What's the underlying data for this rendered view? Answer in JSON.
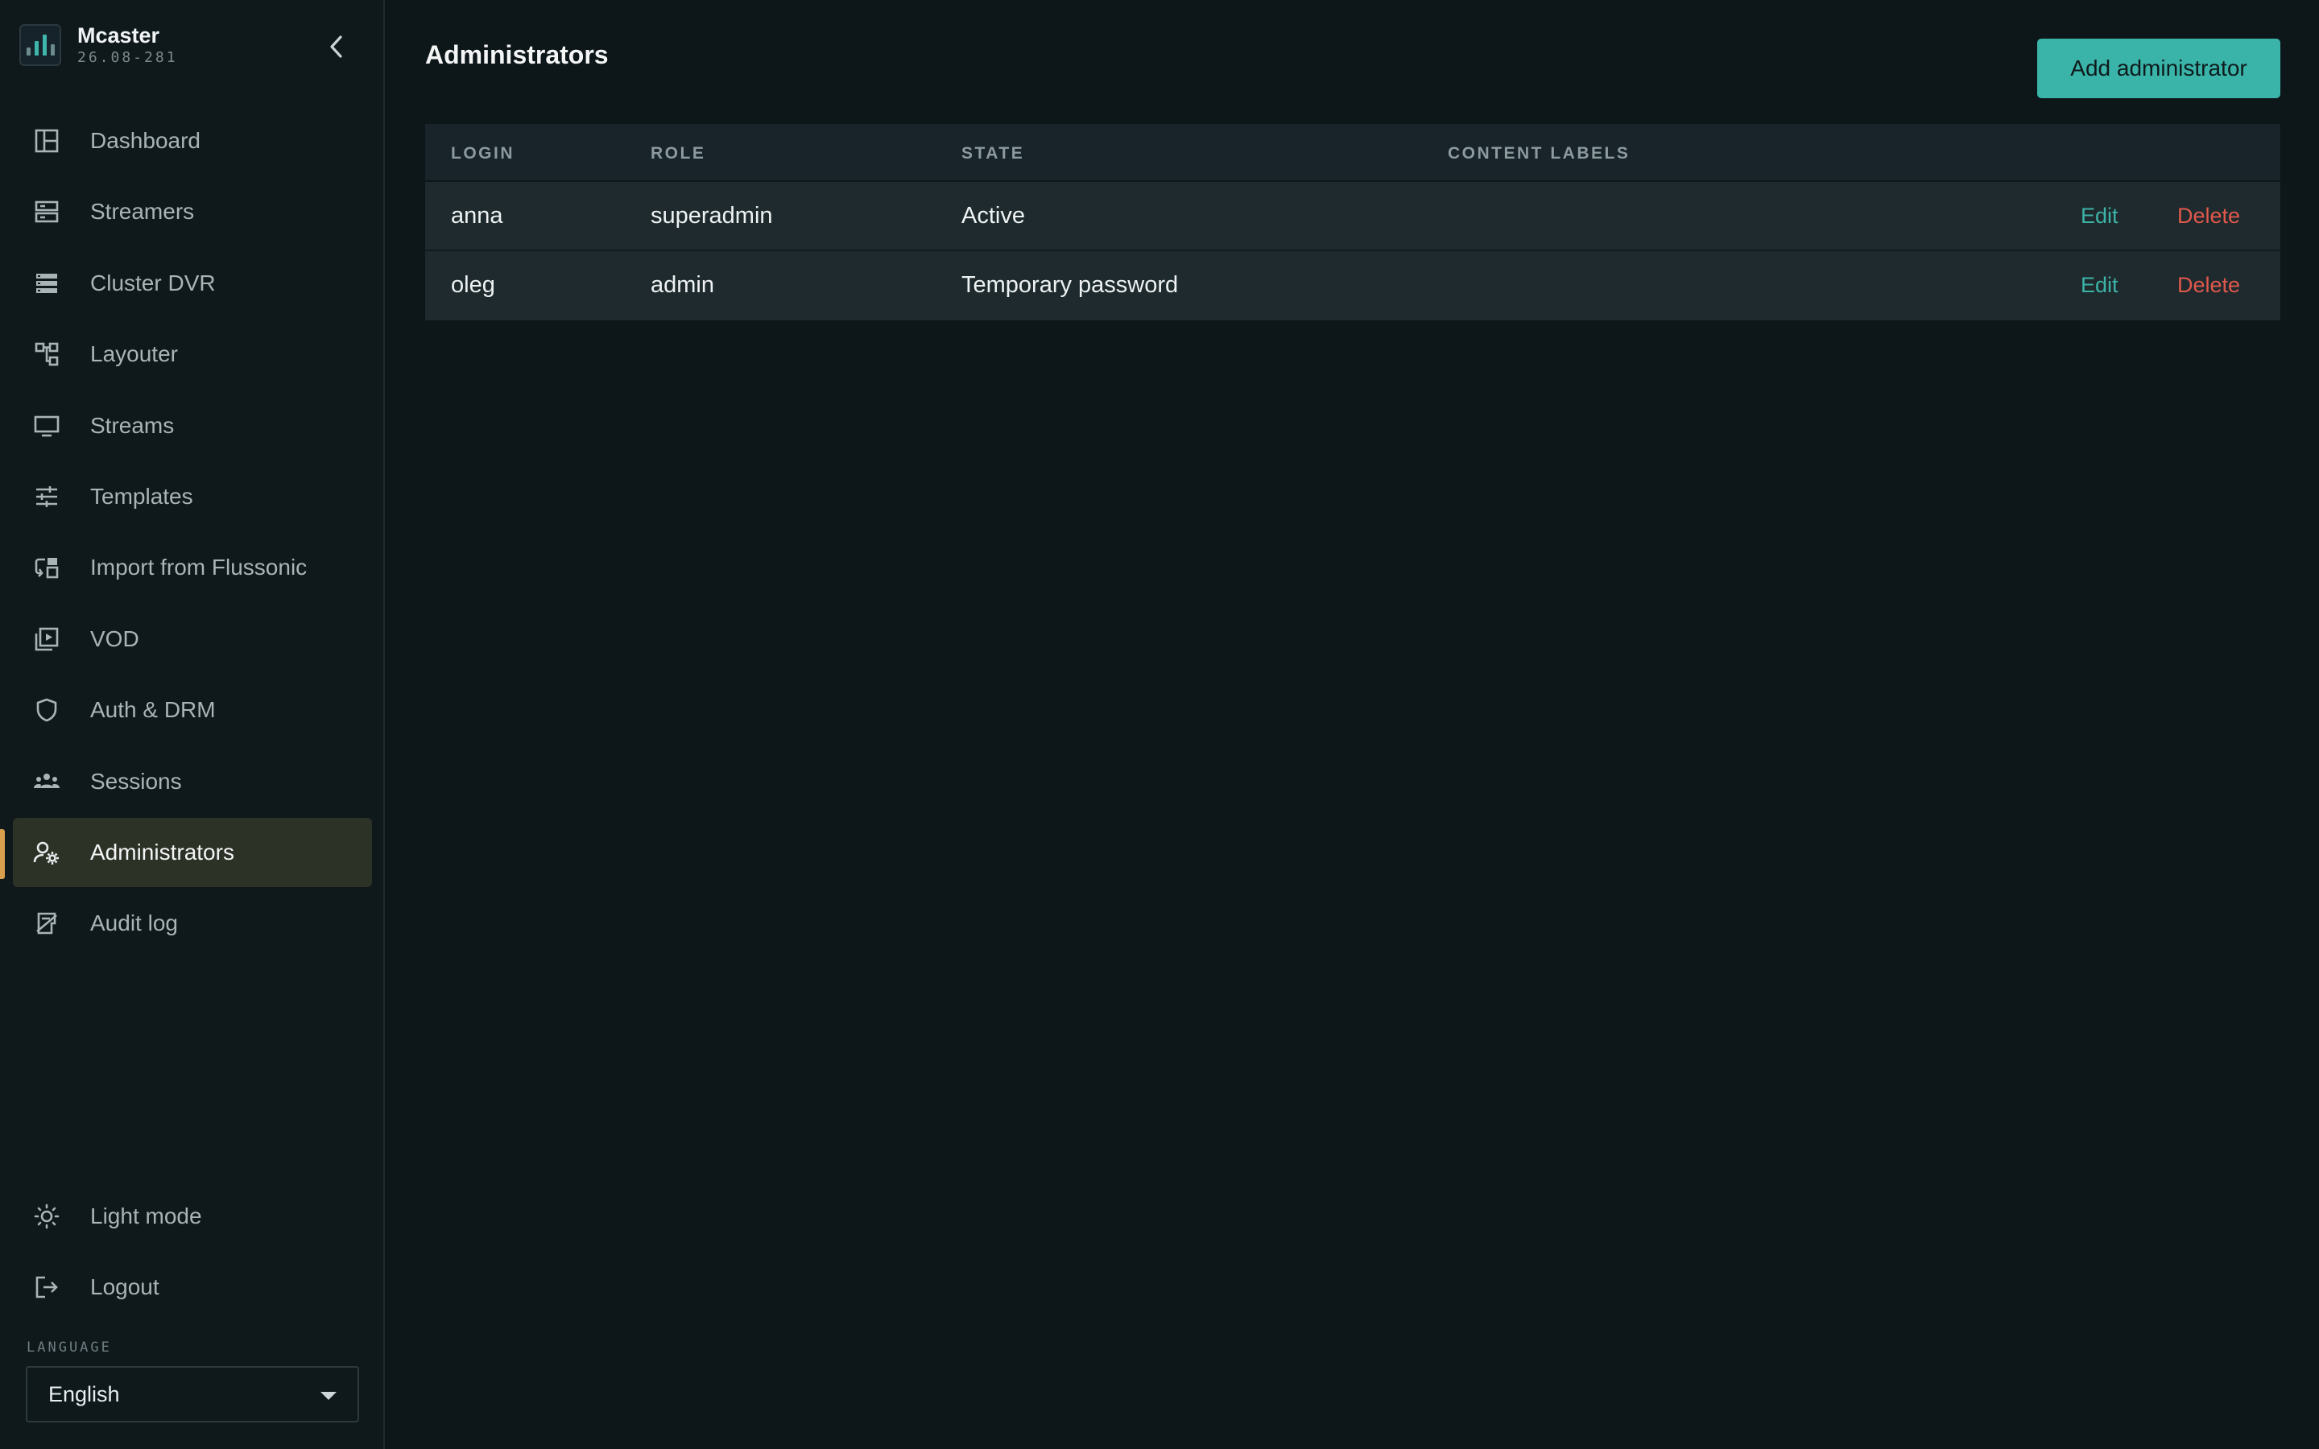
{
  "app": {
    "name": "Mcaster",
    "version": "26.08-281"
  },
  "sidebar": {
    "items": [
      {
        "label": "Dashboard",
        "icon": "dashboard-icon"
      },
      {
        "label": "Streamers",
        "icon": "server-icon"
      },
      {
        "label": "Cluster DVR",
        "icon": "storage-stack-icon"
      },
      {
        "label": "Layouter",
        "icon": "hierarchy-icon"
      },
      {
        "label": "Streams",
        "icon": "monitor-icon"
      },
      {
        "label": "Templates",
        "icon": "sliders-icon"
      },
      {
        "label": "Import from Flussonic",
        "icon": "import-icon"
      },
      {
        "label": "VOD",
        "icon": "video-library-icon"
      },
      {
        "label": "Auth & DRM",
        "icon": "shield-icon"
      },
      {
        "label": "Sessions",
        "icon": "group-icon"
      },
      {
        "label": "Administrators",
        "icon": "user-gear-icon",
        "active": true
      },
      {
        "label": "Audit log",
        "icon": "audit-icon"
      }
    ],
    "bottom": [
      {
        "label": "Light mode",
        "icon": "sun-icon"
      },
      {
        "label": "Logout",
        "icon": "logout-icon"
      }
    ],
    "language": {
      "label": "LANGUAGE",
      "selected": "English"
    }
  },
  "main": {
    "title": "Administrators",
    "add_button": "Add administrator",
    "table": {
      "columns": [
        "LOGIN",
        "ROLE",
        "STATE",
        "CONTENT LABELS"
      ],
      "rows": [
        {
          "login": "anna",
          "role": "superadmin",
          "state": "Active",
          "content_labels": "",
          "edit": "Edit",
          "delete": "Delete"
        },
        {
          "login": "oleg",
          "role": "admin",
          "state": "Temporary password",
          "content_labels": "",
          "edit": "Edit",
          "delete": "Delete"
        }
      ]
    }
  },
  "colors": {
    "accent": "#3ab3a9",
    "danger": "#e0584c",
    "active_marker": "#d8a04c",
    "background": "#0d1619"
  }
}
